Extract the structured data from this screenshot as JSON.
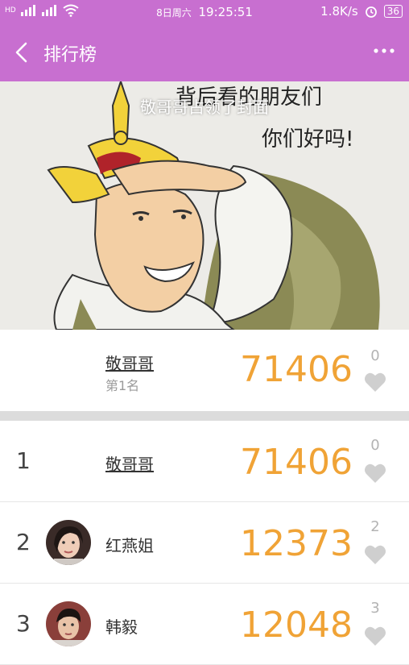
{
  "status_bar": {
    "network_left": "HD",
    "date": "8日周六",
    "time": "19:25:51",
    "speed": "1.8K/s",
    "battery": "36"
  },
  "toolbar": {
    "title": "排行榜",
    "back_icon": "chevron-left-icon",
    "more_icon": "more-dots-icon"
  },
  "cover": {
    "caption": "敬哥哥占领了封面",
    "art_text_line1": "背后看的朋友们",
    "art_text_line2": "你们好吗!"
  },
  "leader": {
    "name": "敬哥哥",
    "rank_label": "第1名",
    "score": "71406",
    "likes": "0"
  },
  "ranking": [
    {
      "rank": "1",
      "name": "敬哥哥",
      "score": "71406",
      "likes": "0",
      "has_avatar": false
    },
    {
      "rank": "2",
      "name": "红燕姐",
      "score": "12373",
      "likes": "2",
      "has_avatar": true
    },
    {
      "rank": "3",
      "name": "韩毅",
      "score": "12048",
      "likes": "3",
      "has_avatar": true
    }
  ],
  "colors": {
    "accent": "#c86fd0",
    "score": "#f0a336",
    "muted": "#b3b3b3"
  }
}
